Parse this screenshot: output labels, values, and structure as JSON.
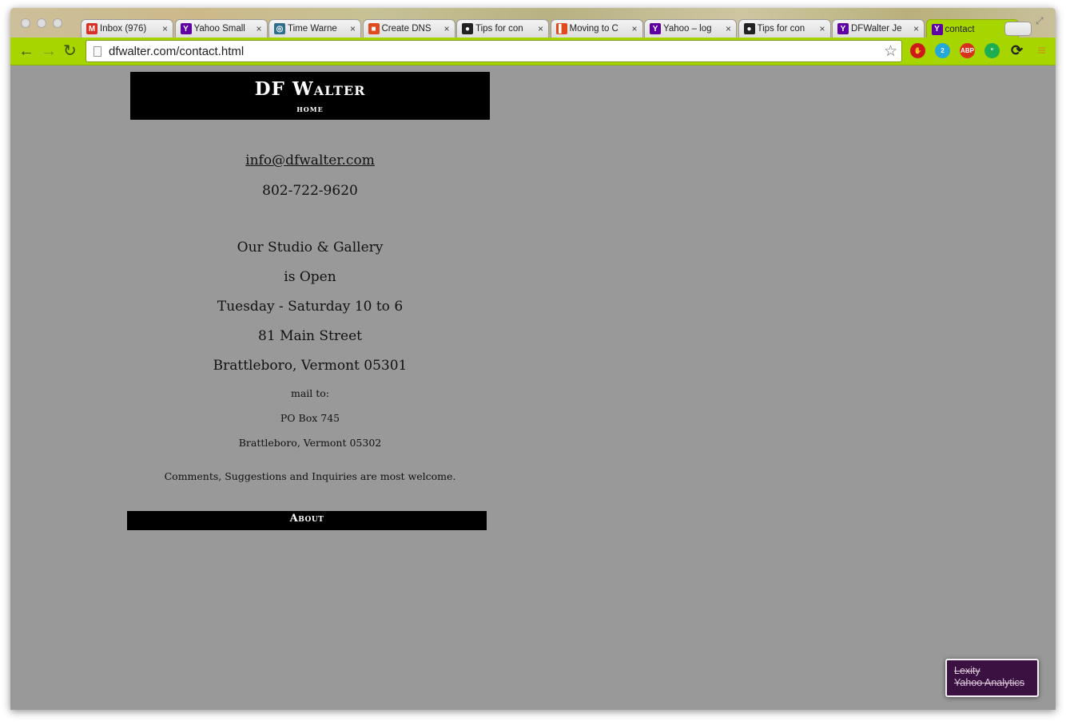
{
  "browser": {
    "tabs": [
      {
        "title": "Inbox (976)",
        "favicon": "gmail-icon",
        "fav_color": "#d93025",
        "fav_glyph": "M",
        "active": false
      },
      {
        "title": "Yahoo Small",
        "favicon": "yahoo-icon",
        "fav_color": "#5f00a3",
        "fav_glyph": "Y",
        "active": false
      },
      {
        "title": "Time Warne",
        "favicon": "time-warner-icon",
        "fav_color": "#2e6f8e",
        "fav_glyph": "◎",
        "active": false
      },
      {
        "title": "Create DNS",
        "favicon": "office-icon",
        "fav_color": "#e04a1e",
        "fav_glyph": "■",
        "active": false
      },
      {
        "title": "Tips for con",
        "favicon": "github-icon",
        "fav_color": "#222222",
        "fav_glyph": "●",
        "active": false
      },
      {
        "title": "Moving to C",
        "favicon": "office-icon",
        "fav_color": "#e04a1e",
        "fav_glyph": "▌",
        "active": false
      },
      {
        "title": "Yahoo – log",
        "favicon": "yahoo-icon",
        "fav_color": "#5f00a3",
        "fav_glyph": "Y",
        "active": false
      },
      {
        "title": "Tips for con",
        "favicon": "github-icon",
        "fav_color": "#222222",
        "fav_glyph": "●",
        "active": false
      },
      {
        "title": "DFWalter Je",
        "favicon": "yahoo-icon",
        "fav_color": "#5f00a3",
        "fav_glyph": "Y",
        "active": false
      },
      {
        "title": "contact",
        "favicon": "yahoo-icon",
        "fav_color": "#5f00a3",
        "fav_glyph": "Y",
        "active": true
      }
    ],
    "url": "dfwalter.com/contact.html",
    "accent": "#a7d500",
    "extensions": [
      {
        "name": "stop-icon",
        "color": "#cc1a1a",
        "glyph": "✋"
      },
      {
        "name": "ghostery-icon",
        "color": "#23a8d8",
        "glyph": "2"
      },
      {
        "name": "adblock-plus-icon",
        "color": "#d7311c",
        "glyph": "ABP"
      },
      {
        "name": "hangouts-icon",
        "color": "#1fae4f",
        "glyph": "“"
      },
      {
        "name": "sync-icon",
        "color": "#222222",
        "glyph": "⟳"
      },
      {
        "name": "menu-icon",
        "color": "#c79a12",
        "glyph": "≡"
      }
    ]
  },
  "site": {
    "brand": "DF Walter",
    "home_link": "home",
    "email": "info@dfwalter.com",
    "phone": "802-722-9620",
    "hours": [
      "Our Studio & Gallery",
      "is Open",
      "Tuesday - Saturday 10 to 6"
    ],
    "street": "81 Main Street",
    "city": "Brattleboro, Vermont 05301",
    "mail_label": "mail to:",
    "po_box": "PO Box 745",
    "mail_city": "Brattleboro, Vermont 05302",
    "comments": "Comments, Suggestions and Inquiries are most welcome.",
    "about_link": "About"
  },
  "lexity": {
    "line1": "Lexity",
    "line2": "Yahoo Analytics",
    "bg_color": "#3b1141"
  }
}
